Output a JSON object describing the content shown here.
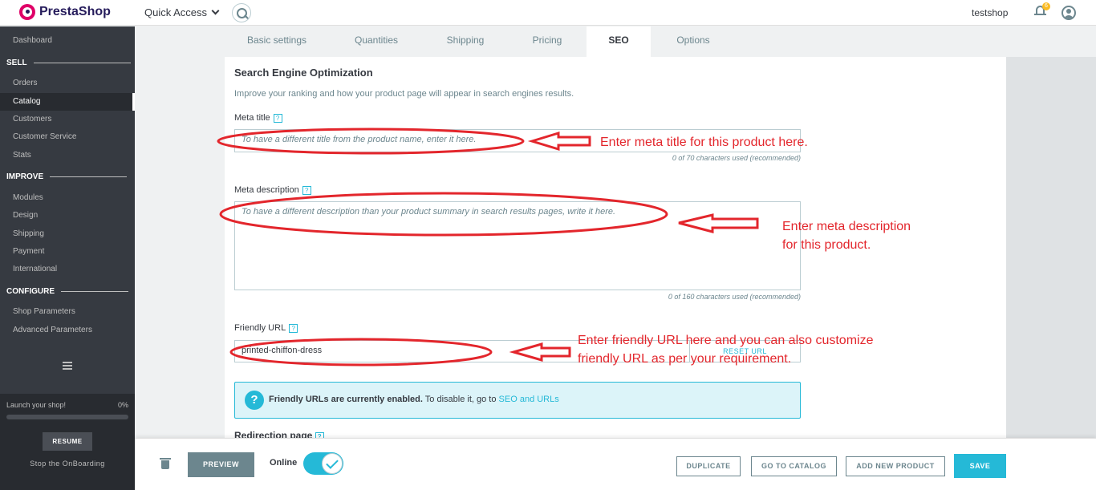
{
  "header": {
    "logo_text": "PrestaShop",
    "quick_access": "Quick Access",
    "shop_name": "testshop",
    "notification_count": "6"
  },
  "sidebar": {
    "dashboard": "Dashboard",
    "section_sell": "SELL",
    "orders": "Orders",
    "catalog": "Catalog",
    "customers": "Customers",
    "customer_service": "Customer Service",
    "stats": "Stats",
    "section_improve": "IMPROVE",
    "modules": "Modules",
    "design": "Design",
    "shipping": "Shipping",
    "payment": "Payment",
    "international": "International",
    "section_configure": "CONFIGURE",
    "shop_parameters": "Shop Parameters",
    "advanced_parameters": "Advanced Parameters",
    "onboarding": {
      "launch_label": "Launch your shop!",
      "percent": "0%",
      "progress": 0,
      "resume": "RESUME",
      "stop": "Stop the OnBoarding"
    }
  },
  "tabs": {
    "basic_settings": "Basic settings",
    "quantities": "Quantities",
    "shipping": "Shipping",
    "pricing": "Pricing",
    "seo": "SEO",
    "options": "Options",
    "active": "SEO"
  },
  "seo": {
    "title": "Search Engine Optimization",
    "subtitle": "Improve your ranking and how your product page will appear in search engines results.",
    "meta_title_label": "Meta title",
    "meta_title_placeholder": "To have a different title from the product name, enter it here.",
    "meta_title_counter": "0 of 70 characters used (recommended)",
    "meta_description_label": "Meta description",
    "meta_description_placeholder": "To have a different description than your product summary in search results pages, write it here.",
    "meta_description_counter": "0 of 160 characters used (recommended)",
    "friendly_url_label": "Friendly URL",
    "friendly_url_value": "printed-chiffon-dress",
    "reset_url": "RESET URL",
    "help_glyph": "?",
    "alert_icon": "?",
    "alert_bold": "Friendly URLs are currently enabled.",
    "alert_text": " To disable it, go to ",
    "alert_link": "SEO and URLs",
    "redirection_label": "Redirection page"
  },
  "annotations": {
    "meta_title": "Enter meta title for this product here.",
    "meta_description_line1": "Enter meta description",
    "meta_description_line2": "for this product.",
    "friendly_url_line1": "Enter friendly URL here and you can also customize",
    "friendly_url_line2": "friendly URL as per your requirement.",
    "color": "#e3262c"
  },
  "footer": {
    "preview": "PREVIEW",
    "online": "Online",
    "online_enabled": true,
    "duplicate": "DUPLICATE",
    "go_to_catalog": "GO TO CATALOG",
    "add_new_product": "ADD NEW PRODUCT",
    "save": "SAVE"
  },
  "colors": {
    "accent": "#25b9d7",
    "sidebar_bg": "#363a41",
    "brand_pink": "#df0067"
  },
  "icons": [
    "prestashop-logo-icon",
    "chevron-down-icon",
    "search-icon",
    "bell-icon",
    "user-icon",
    "help-icon",
    "hamburger-icon",
    "question-circle-icon",
    "trash-icon",
    "check-icon",
    "arrow-left-icon"
  ]
}
